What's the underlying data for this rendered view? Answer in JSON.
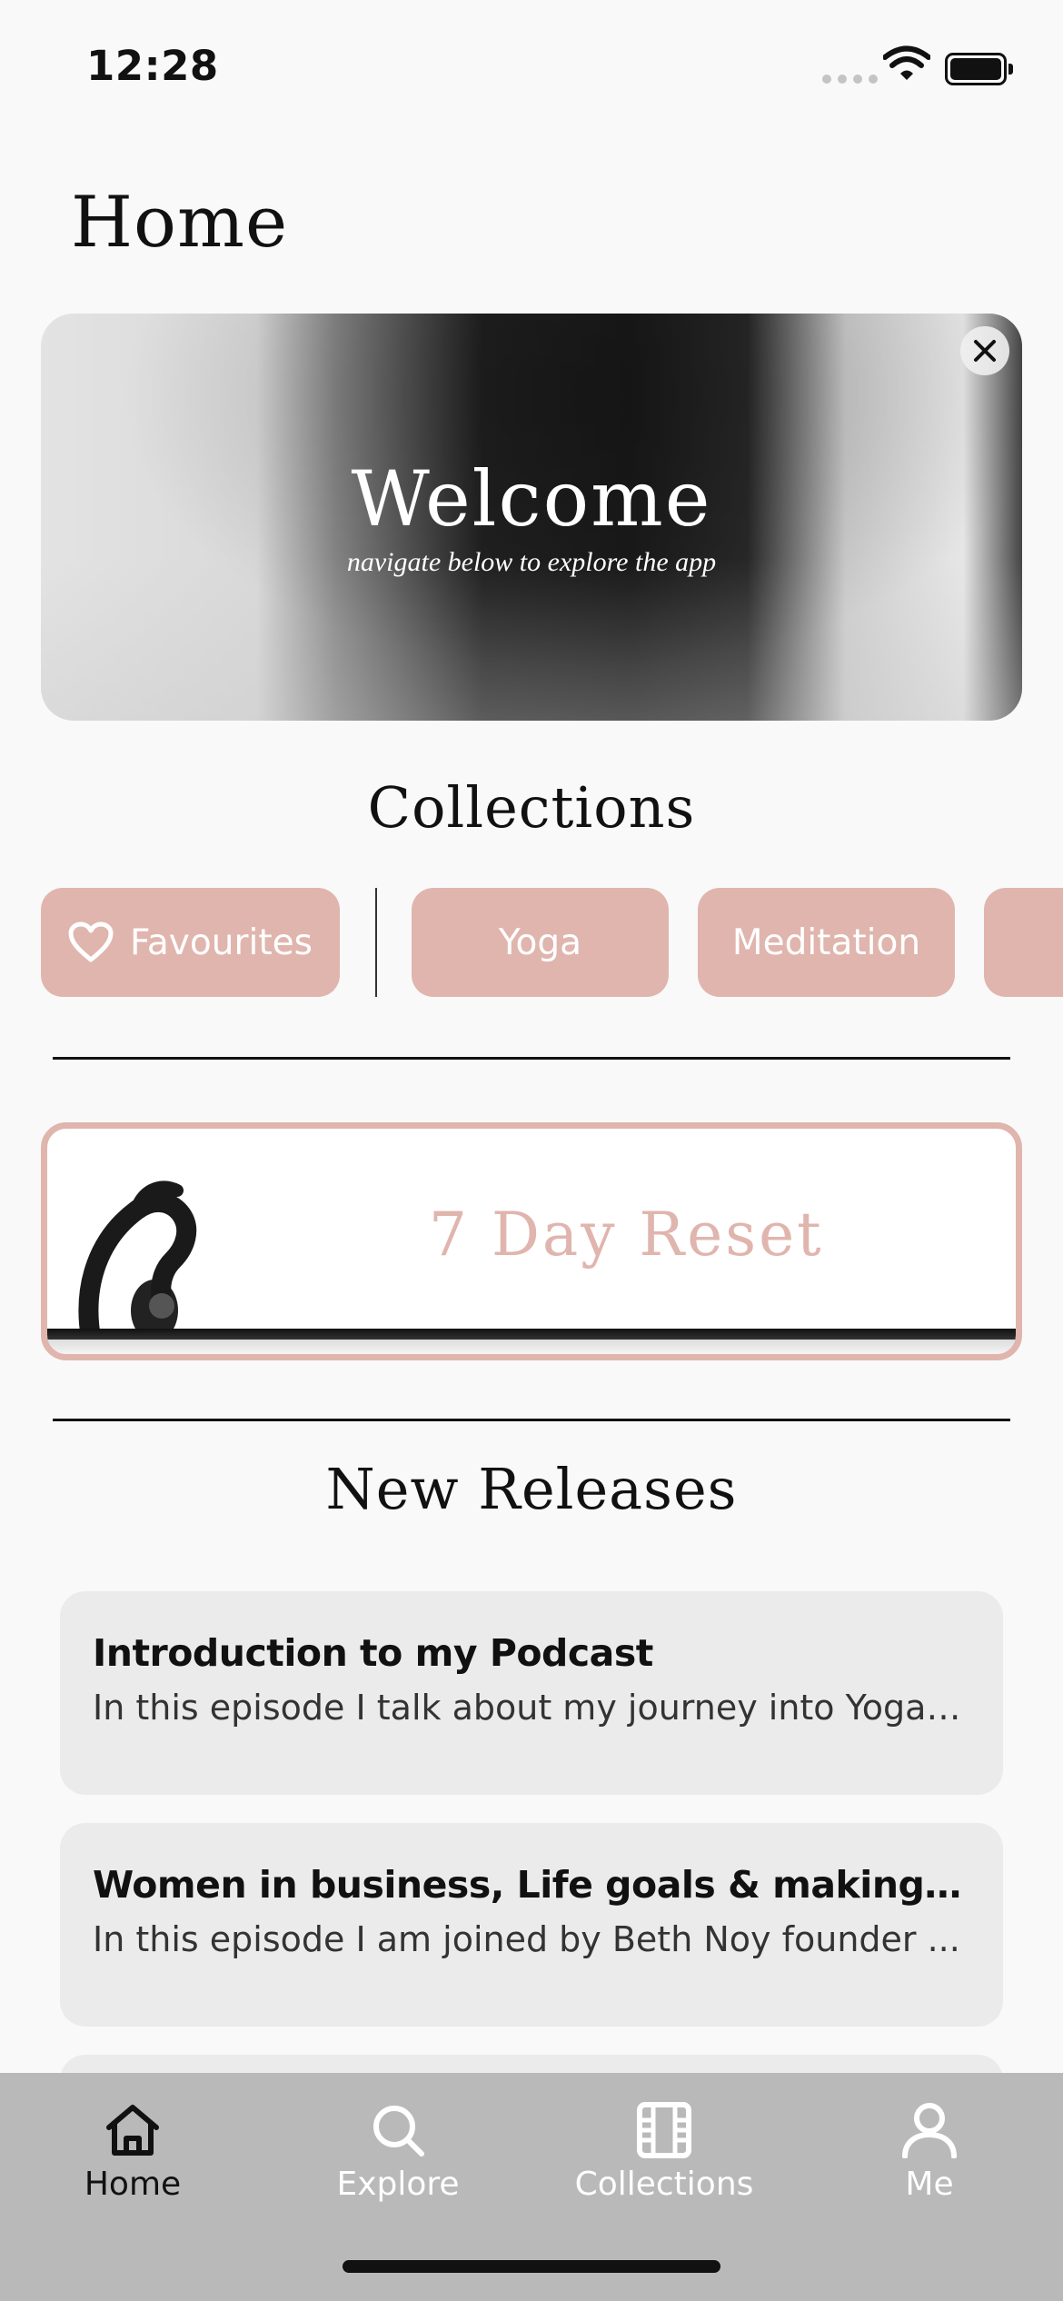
{
  "status_bar": {
    "time": "12:28"
  },
  "page": {
    "title": "Home"
  },
  "hero": {
    "title": "Welcome",
    "subtitle": "navigate below to explore the app"
  },
  "collections": {
    "title": "Collections",
    "chips": [
      {
        "label": "Favourites",
        "icon": "heart-icon"
      },
      {
        "label": "Yoga"
      },
      {
        "label": "Meditation"
      },
      {
        "label": ""
      }
    ]
  },
  "program": {
    "title": "7 Day Reset"
  },
  "new_releases": {
    "title": "New Releases",
    "items": [
      {
        "title": "Introduction to my Podcast",
        "description": "In this episode I talk about my journey into Yoga, ..."
      },
      {
        "title": "Women in business, Life goals & making a ...",
        "description": "In this episode I am joined by Beth Noy founder ..."
      }
    ]
  },
  "tab_bar": {
    "items": [
      {
        "label": "Home",
        "icon": "home-icon",
        "active": true
      },
      {
        "label": "Explore",
        "icon": "search-icon"
      },
      {
        "label": "Collections",
        "icon": "film-icon"
      },
      {
        "label": "Me",
        "icon": "person-icon"
      }
    ]
  },
  "colors": {
    "accent": "#e0b5ae",
    "tab_bar": "#b9b9b9",
    "card": "#ebebeb"
  }
}
